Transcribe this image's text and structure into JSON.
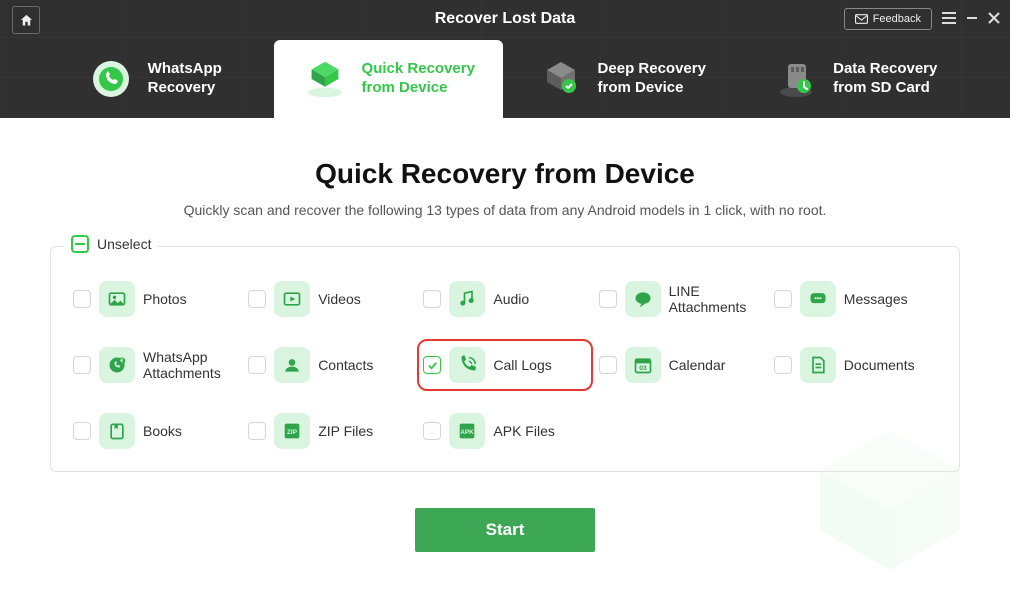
{
  "window": {
    "title": "Recover Lost Data",
    "feedback": "Feedback"
  },
  "tabs": [
    {
      "line1": "WhatsApp",
      "line2": "Recovery"
    },
    {
      "line1": "Quick Recovery",
      "line2": "from Device"
    },
    {
      "line1": "Deep Recovery",
      "line2": "from Device"
    },
    {
      "line1": "Data Recovery",
      "line2": "from SD Card"
    }
  ],
  "page": {
    "title": "Quick Recovery from Device",
    "subtitle": "Quickly scan and recover the following 13 types of data from any Android models in 1 click, with no root."
  },
  "unselect_label": "Unselect",
  "items": {
    "photos": "Photos",
    "videos": "Videos",
    "audio": "Audio",
    "line_attachments": "LINE Attachments",
    "messages": "Messages",
    "whatsapp_attachments": "WhatsApp Attachments",
    "contacts": "Contacts",
    "call_logs": "Call Logs",
    "calendar": "Calendar",
    "documents": "Documents",
    "books": "Books",
    "zip_files": "ZIP Files",
    "apk_files": "APK Files"
  },
  "start_label": "Start",
  "colors": {
    "accent": "#34c74a",
    "highlight": "#e53935",
    "start_btn": "#3ca856"
  }
}
